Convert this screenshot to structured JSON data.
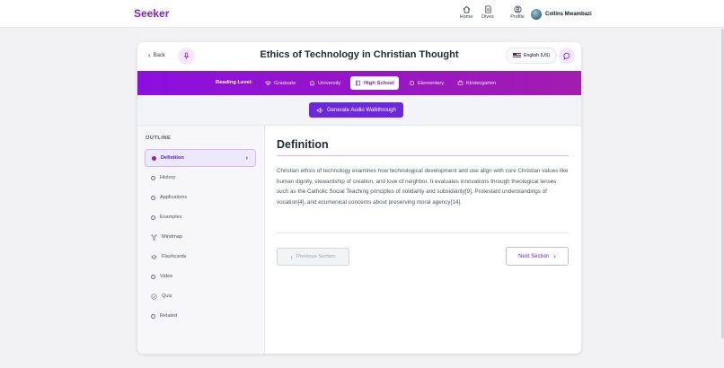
{
  "app": {
    "brand": "Seeker"
  },
  "topnav": {
    "items": [
      {
        "label": "Home",
        "icon": "home-icon"
      },
      {
        "label": "Dives",
        "icon": "document-icon"
      },
      {
        "label": "Profile",
        "icon": "user-icon"
      }
    ],
    "user_name": "Collins Mwambazi"
  },
  "header": {
    "back_label": "Back",
    "title": "Ethics of Technology in Christian Thought",
    "language": "English (US)"
  },
  "reading_level": {
    "label": "Reading Level:",
    "levels": [
      {
        "label": "Graduate",
        "active": false
      },
      {
        "label": "University",
        "active": false
      },
      {
        "label": "High School",
        "active": true
      },
      {
        "label": "Elementary",
        "active": false
      },
      {
        "label": "Kindergarten",
        "active": false
      }
    ]
  },
  "audio": {
    "button_label": "Generate Audio Walkthrough"
  },
  "outline": {
    "title": "OUTLINE",
    "items": [
      {
        "label": "Definition",
        "active": true
      },
      {
        "label": "History"
      },
      {
        "label": "Applications"
      },
      {
        "label": "Examples"
      },
      {
        "label": "Mindmap"
      },
      {
        "label": "Flashcards"
      },
      {
        "label": "Video"
      },
      {
        "label": "Quiz"
      },
      {
        "label": "Related"
      }
    ]
  },
  "section": {
    "title": "Definition",
    "body": "Christian ethics of technology examines how technological development and use align with core Christian values like human dignity, stewardship of creation, and love of neighbor. It evaluates innovations through theological lenses such as the Catholic Social Teaching principles of solidarity and subsidiarity[9], Protestant understandings of vocation[4], and ecumenical concerns about preserving moral agency[14].",
    "prev_label": "Previous Section",
    "next_label": "Next Section"
  },
  "colors": {
    "accent": "#7e22ce",
    "level_bar": "#9b12e6",
    "audio_button": "#6d28d9"
  }
}
